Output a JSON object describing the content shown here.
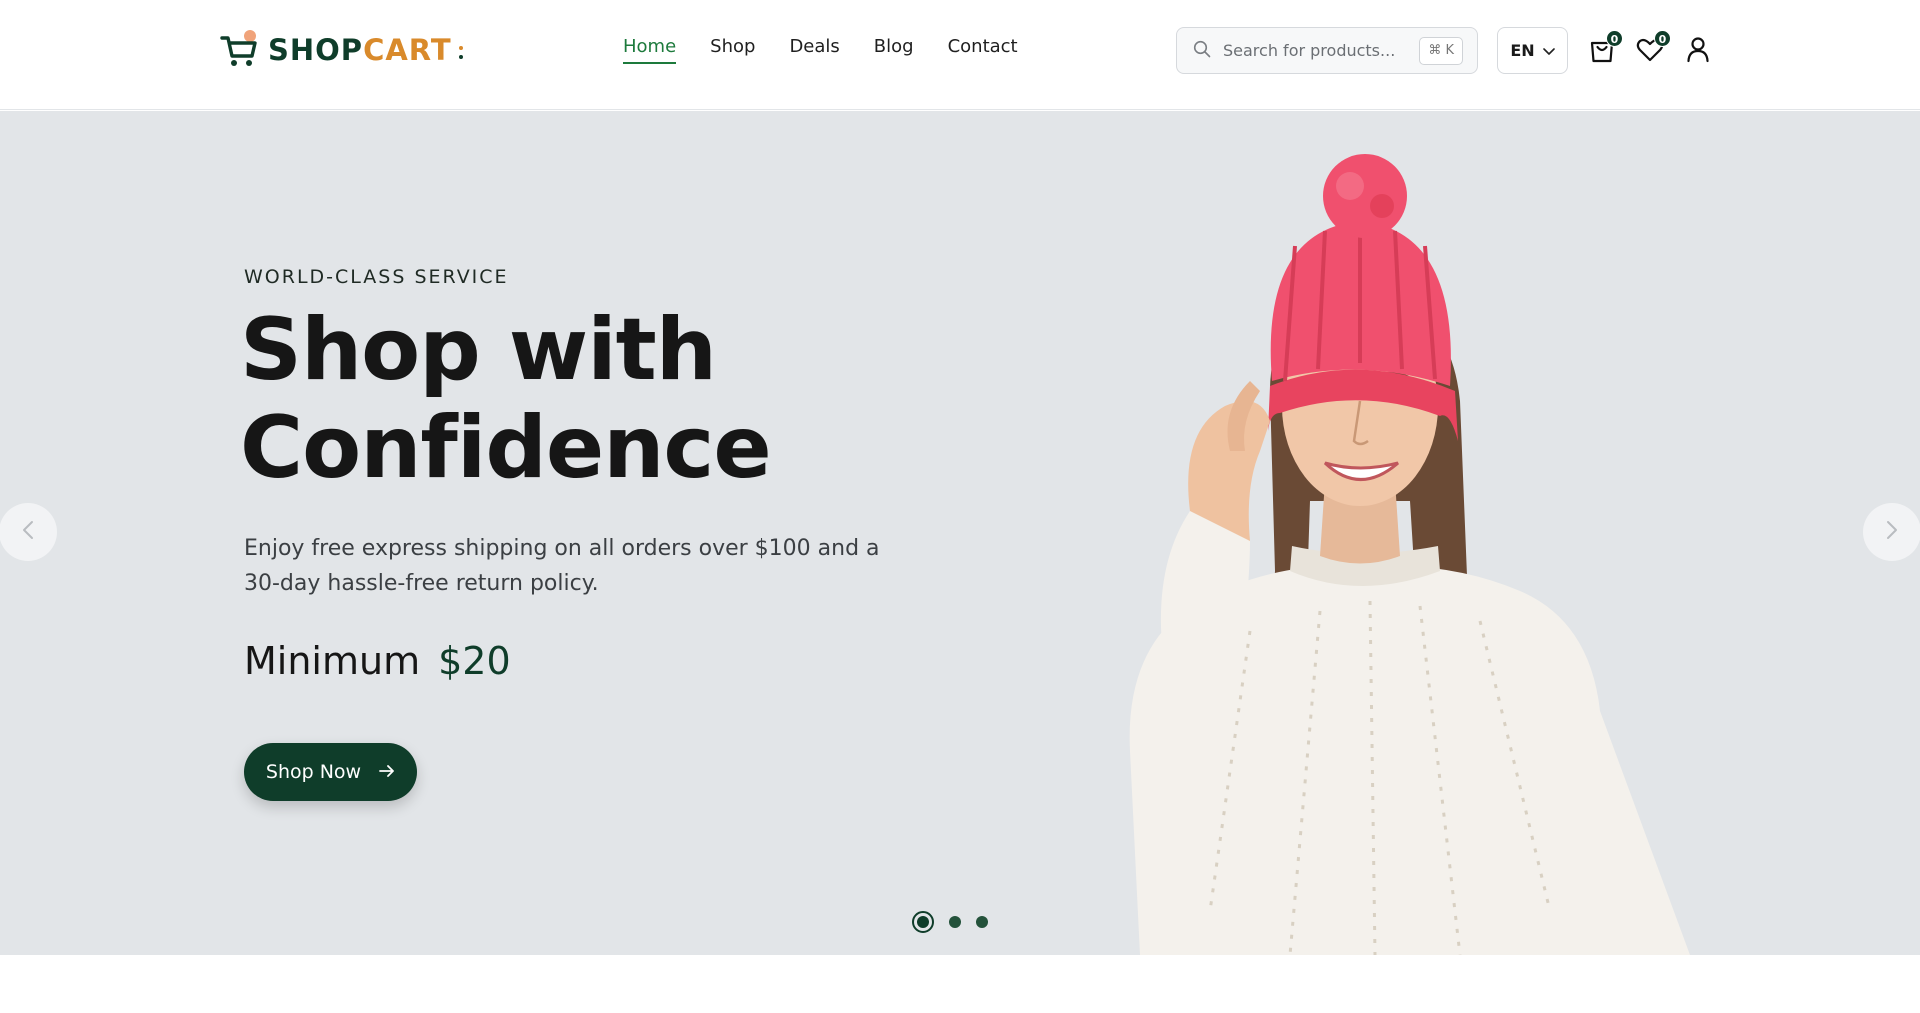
{
  "header": {
    "logo": {
      "part1": "SHOP",
      "part2": "CART"
    },
    "nav": [
      {
        "label": "Home",
        "active": true
      },
      {
        "label": "Shop",
        "active": false
      },
      {
        "label": "Deals",
        "active": false
      },
      {
        "label": "Blog",
        "active": false
      },
      {
        "label": "Contact",
        "active": false
      }
    ],
    "search": {
      "placeholder": "Search for products...",
      "shortcut": "⌘ K",
      "icon": "search-icon"
    },
    "language": "EN",
    "cart_count": "0",
    "wishlist_count": "0",
    "icons": [
      "cart-icon",
      "heart-icon",
      "user-icon"
    ]
  },
  "hero": {
    "eyebrow": "WORLD-CLASS SERVICE",
    "headline_line1": "Shop with",
    "headline_line2": "Confidence",
    "description": "Enjoy free express shipping on all orders over $100 and a 30-day hassle-free return policy.",
    "price_label": "Minimum",
    "price_value": "$20",
    "cta_label": "Shop Now",
    "slides_total": 3,
    "active_slide": 1
  },
  "colors": {
    "brand_dark": "#0f3d2a",
    "brand_accent": "#d98a2b",
    "nav_active": "#1d7a3c",
    "hero_bg": "#e2e5e8",
    "beanie": "#f0506e",
    "sweater": "#f4f1ec"
  }
}
